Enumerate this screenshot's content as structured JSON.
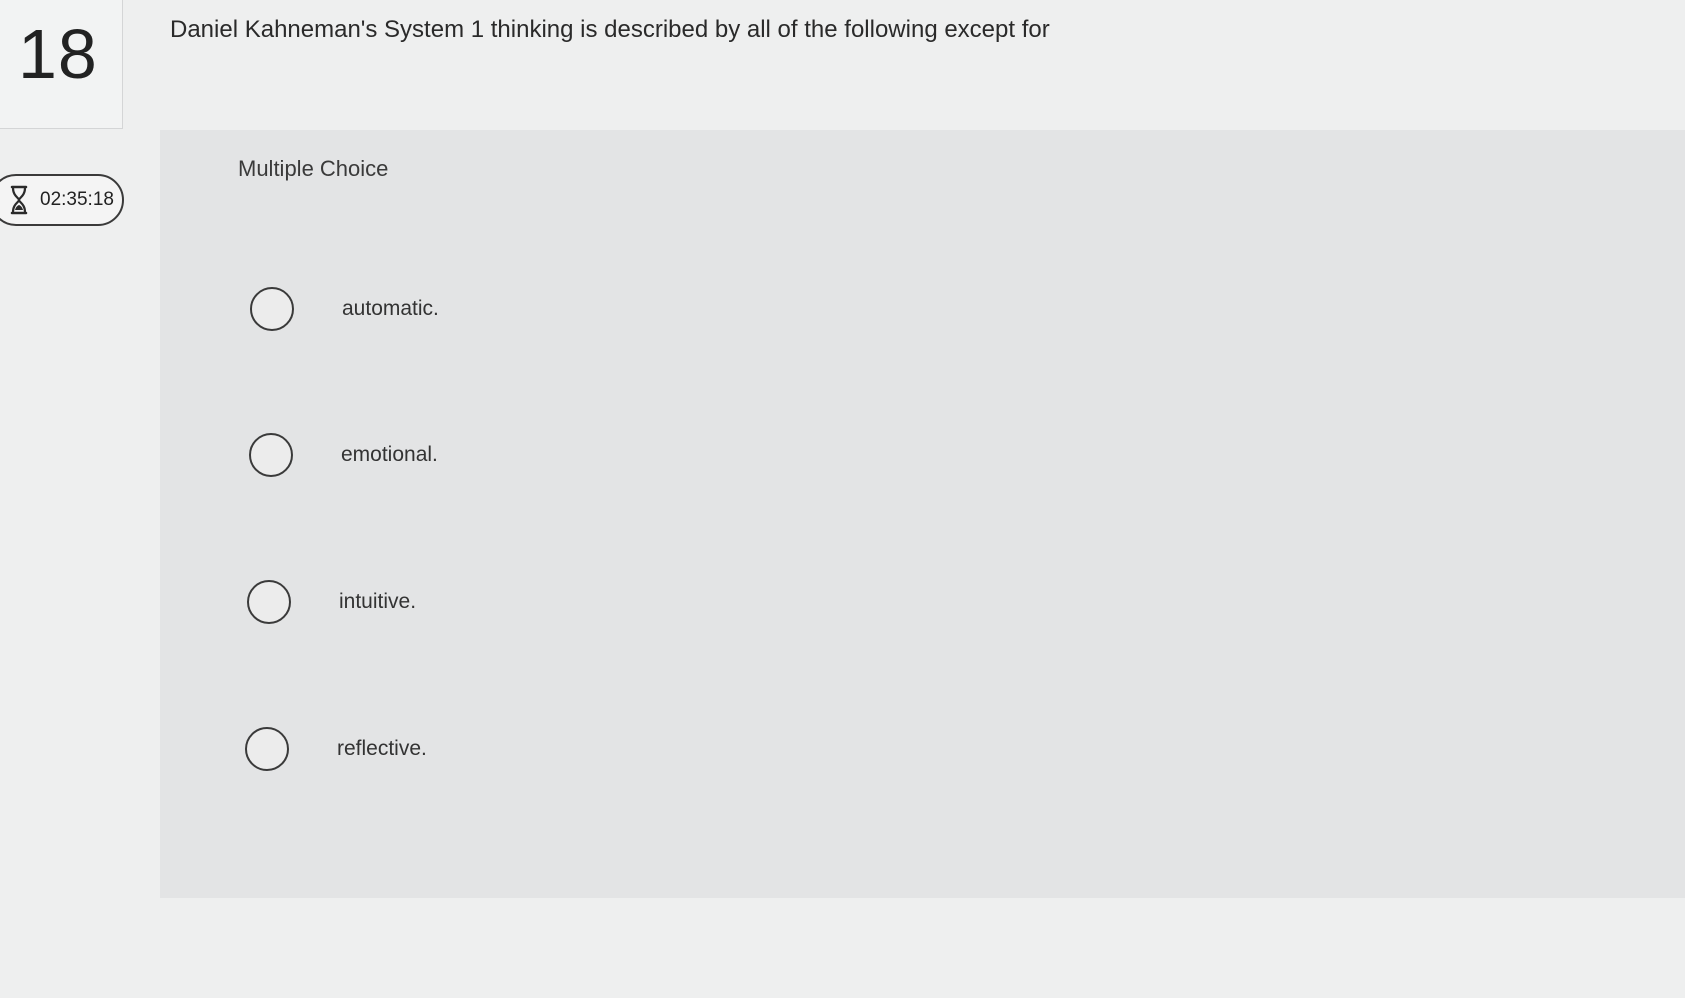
{
  "question": {
    "number": "18",
    "text": "Daniel Kahneman's System 1 thinking is described by all of the following except for",
    "type_label": "Multiple Choice"
  },
  "timer": {
    "icon": "hourglass-icon",
    "time": "02:35:18"
  },
  "options": [
    {
      "label": "automatic."
    },
    {
      "label": "emotional."
    },
    {
      "label": "intuitive."
    },
    {
      "label": "reflective."
    }
  ]
}
